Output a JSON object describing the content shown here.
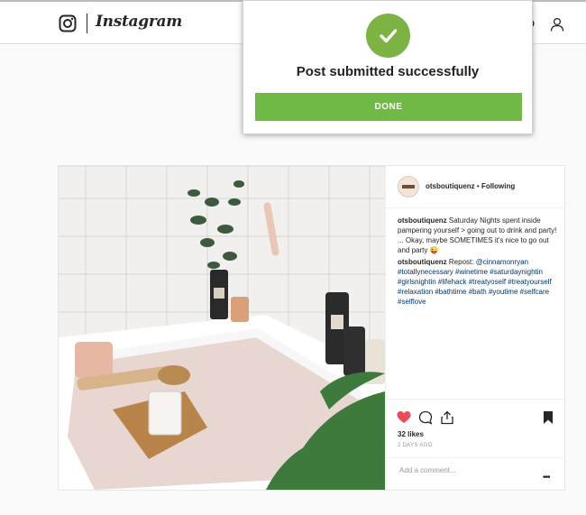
{
  "header": {
    "logo_icon": "instagram-camera-icon",
    "wordmark": "Instagram",
    "profile_icon": "person-icon"
  },
  "modal": {
    "icon": "checkmark-icon",
    "icon_color": "#7cb342",
    "title": "Post submitted successfully",
    "done_label": "DONE",
    "done_color": "#6fba44"
  },
  "post": {
    "username": "otsboutiquenz",
    "separator": "•",
    "follow_status": "Following",
    "comments": [
      {
        "user": "otsboutiquenz",
        "text": "Saturday Nights spent inside pampering yourself > going out to drink and party! ... Okay, maybe SOMETIMES it's nice to go out and party 😜"
      },
      {
        "user": "otsboutiquenz",
        "text": "Repost: ",
        "tags": "@cinnamonryan #totallynecessary #winetime #saturdaynightin #girlsnightin #lifehack #treatyoself #treatyourself #relaxation #bathtime #bath #youtime #selfcare #selflove"
      }
    ],
    "likes": "32 likes",
    "date": "2 DAYS AGO",
    "comment_placeholder": "Add a comment...",
    "more_label": "•••",
    "like_color": "#ed4956"
  }
}
